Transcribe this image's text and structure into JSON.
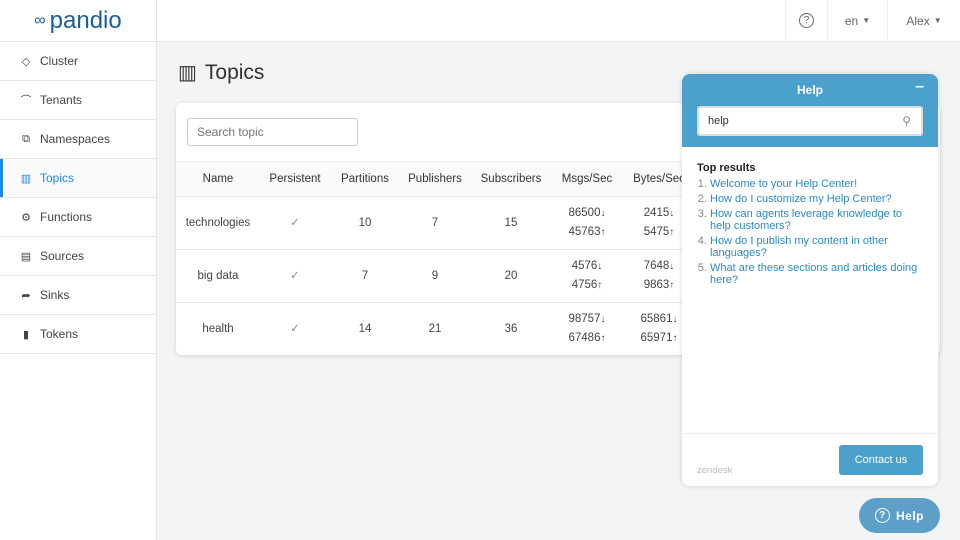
{
  "brand": "pandio",
  "sidebar": {
    "items": [
      {
        "label": "Cluster",
        "icon": "cluster-icon",
        "glyph": "◇"
      },
      {
        "label": "Tenants",
        "icon": "tenants-icon",
        "glyph": "⌒"
      },
      {
        "label": "Namespaces",
        "icon": "namespaces-icon",
        "glyph": "⧉"
      },
      {
        "label": "Topics",
        "icon": "topics-icon",
        "glyph": "▥",
        "active": true
      },
      {
        "label": "Functions",
        "icon": "functions-icon",
        "glyph": "⚙"
      },
      {
        "label": "Sources",
        "icon": "sources-icon",
        "glyph": "▤"
      },
      {
        "label": "Sinks",
        "icon": "sinks-icon",
        "glyph": "➦"
      },
      {
        "label": "Tokens",
        "icon": "tokens-icon",
        "glyph": "▮"
      }
    ]
  },
  "header": {
    "help_icon": "?",
    "language": "en",
    "user": "Alex"
  },
  "page": {
    "title": "Topics",
    "search_placeholder": "Search topic"
  },
  "table": {
    "columns": [
      "Name",
      "Persistent",
      "Partitions",
      "Publishers",
      "Subscribers",
      "Msgs/Sec",
      "Bytes/Sec"
    ],
    "rows": [
      {
        "name": "technologies",
        "persistent": "✓",
        "partitions": "10",
        "publishers": "7",
        "subscribers": "15",
        "msgs_in": "86500",
        "msgs_out": "45763",
        "bytes_in": "2415",
        "bytes_out": "5475"
      },
      {
        "name": "big data",
        "persistent": "✓",
        "partitions": "7",
        "publishers": "9",
        "subscribers": "20",
        "msgs_in": "4576",
        "msgs_out": "4756",
        "bytes_in": "7648",
        "bytes_out": "9863"
      },
      {
        "name": "health",
        "persistent": "✓",
        "partitions": "14",
        "publishers": "21",
        "subscribers": "36",
        "msgs_in": "98757",
        "msgs_out": "67486",
        "bytes_in": "65861",
        "bytes_out": "65971"
      }
    ]
  },
  "help_widget": {
    "title": "Help",
    "search_value": "help",
    "results_heading": "Top results",
    "results": [
      "Welcome to your Help Center!",
      "How do I customize my Help Center?",
      "How can agents leverage knowledge to help customers?",
      "How do I publish my content in other languages?",
      "What are these sections and articles doing here?"
    ],
    "contact_label": "Contact us",
    "footer_brand": "zendesk",
    "launcher_label": "Help"
  },
  "colors": {
    "accent": "#1e88e5",
    "brand": "#1a5e9c",
    "help_blue": "#4ba0cc"
  }
}
